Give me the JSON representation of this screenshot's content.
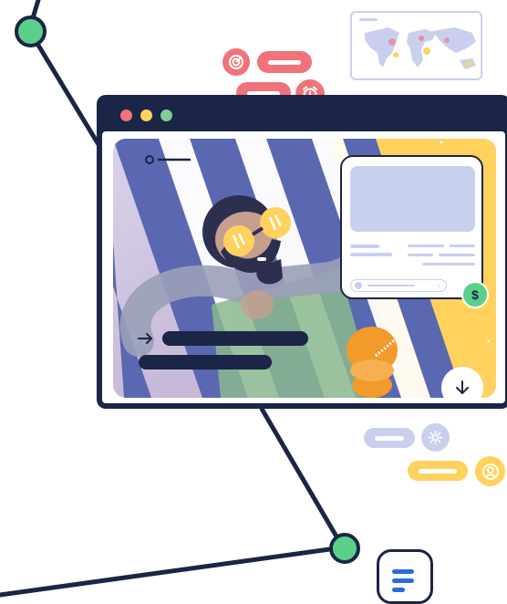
{
  "colors": {
    "navy": "#1b2545",
    "accent_green": "#5bd08a",
    "coral": "#f0737a",
    "yellow": "#ffd25e",
    "lavender": "#c9d0ee",
    "stripe_blue": "#5a68b2",
    "orange": "#f29a2b"
  },
  "icons": {
    "radar": "radar-icon",
    "alarm": "alarm-clock-icon",
    "dollar": "dollar-icon",
    "download": "arrow-down-icon",
    "settings": "gear-icon",
    "user": "user-circle-icon",
    "document": "document-icon",
    "arrow": "arrow-right-icon"
  },
  "card": {
    "currency_symbol": "$"
  }
}
